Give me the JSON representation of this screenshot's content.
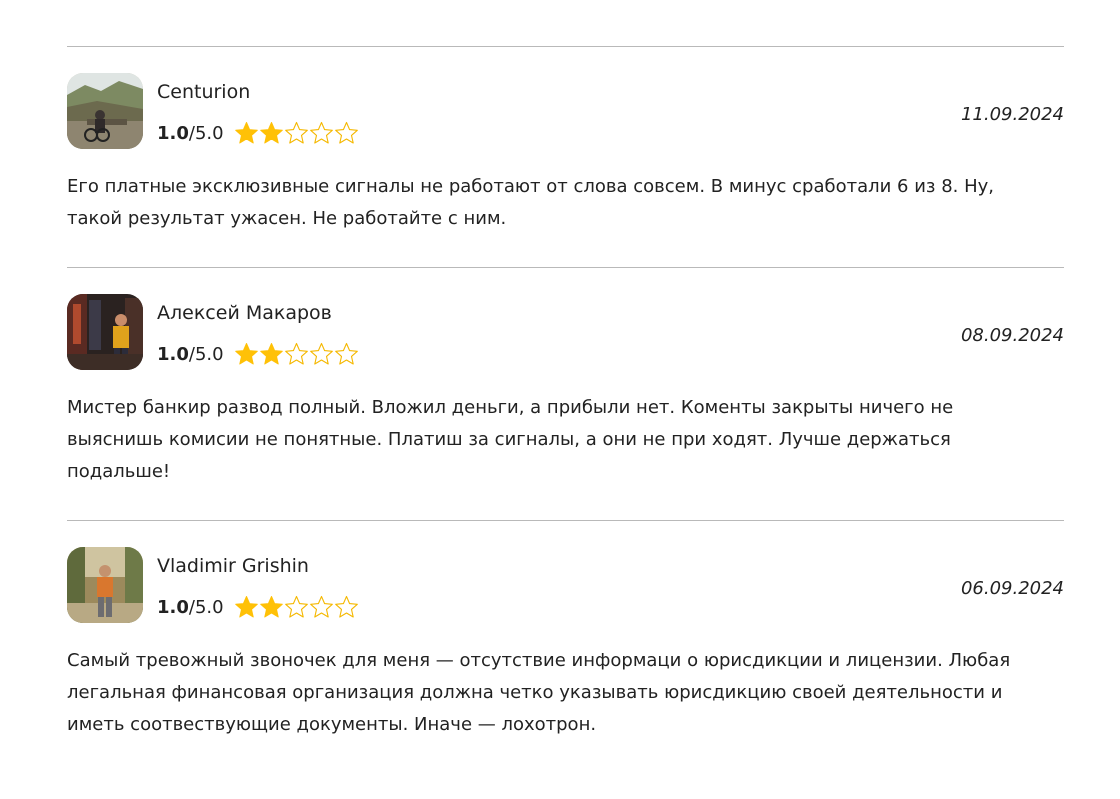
{
  "reviews": [
    {
      "author": "Centurion",
      "rating_value": "1.0",
      "rating_max": "/5.0",
      "stars_filled": 2,
      "stars_total": 5,
      "date": "11.09.2024",
      "text": "Его платные эксклюзивные сигналы не работают от слова совсем. В минус сработали 6 из 8. Ну, такой результат ужасен. Не работайте с ним."
    },
    {
      "author": "Алексей Макаров",
      "rating_value": "1.0",
      "rating_max": "/5.0",
      "stars_filled": 2,
      "stars_total": 5,
      "date": "08.09.2024",
      "text": "Мистер банкир развод полный. Вложил деньги, а прибыли нет. Коменты закрыты ничего не выяснишь комисии не понятные. Платиш за сигналы, а они не при ходят. Лучше держаться подальше!"
    },
    {
      "author": "Vladimir Grishin",
      "rating_value": "1.0",
      "rating_max": "/5.0",
      "stars_filled": 2,
      "stars_total": 5,
      "date": "06.09.2024",
      "text": "Самый тревожный звоночек для меня — отсутствие информаци о юрисдикции и лицензии. Любая легальная финансовая организация должна четко указывать юрисдикцию своей деятельности и иметь соотвествующие документы. Иначе — лохотрон."
    }
  ],
  "colors": {
    "star_filled": "#ffc107",
    "star_outline": "#f5b800",
    "divider": "#b9b9b9",
    "text": "#222222"
  },
  "icons": {
    "star_filled": "star-filled-icon",
    "star_empty": "star-empty-icon"
  }
}
